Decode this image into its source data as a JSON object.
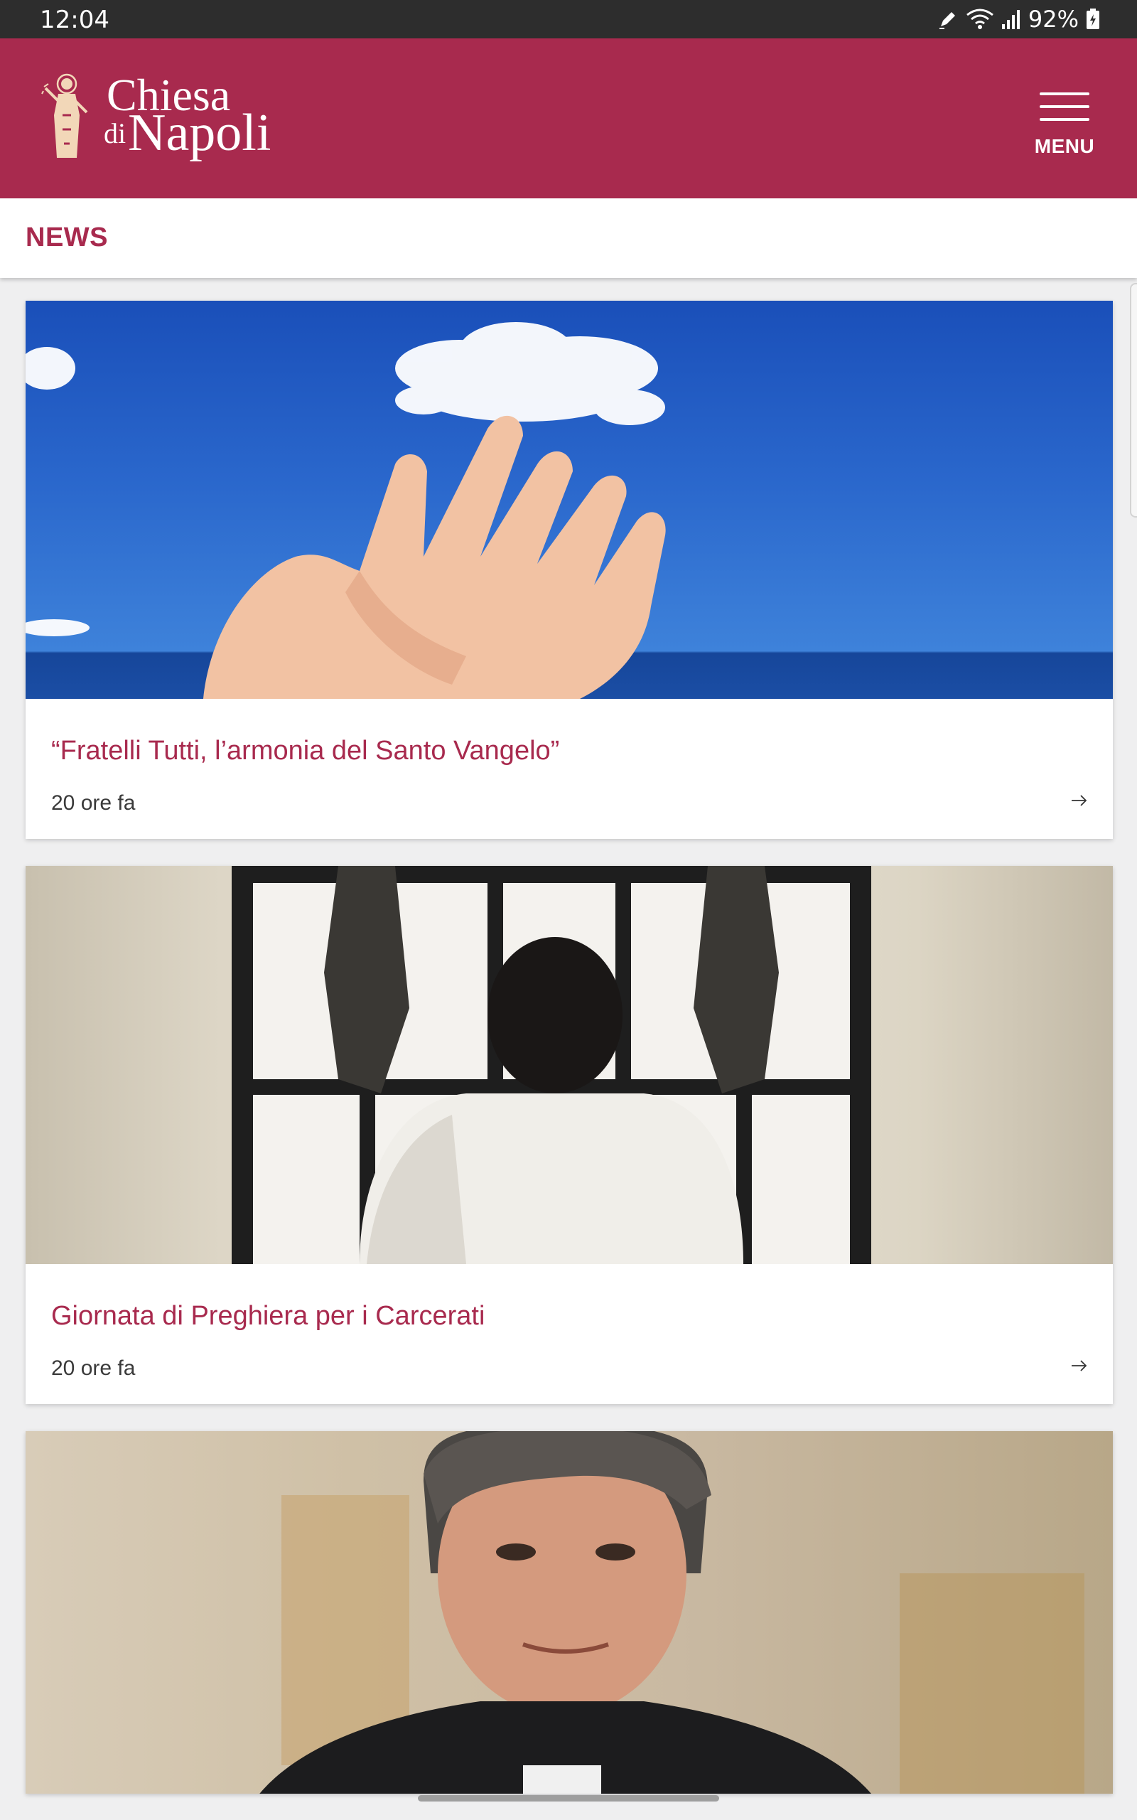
{
  "status_bar": {
    "time": "12:04",
    "battery": "92%",
    "icons": [
      "edit-pen-icon",
      "wifi-icon",
      "signal-icon",
      "battery-icon"
    ]
  },
  "app_bar": {
    "logo": {
      "line1": "Chiesa",
      "line2_prefix": "di",
      "line2": "Napoli"
    },
    "menu_label": "MENU",
    "background_color": "#a82a4e"
  },
  "section": {
    "title": "NEWS"
  },
  "articles": [
    {
      "title": "“Fratelli Tutti, l’armonia del Santo Vangelo”",
      "time": "20 ore fa",
      "image": "open hand under a cloud in blue sky"
    },
    {
      "title": "Giornata di Preghiera per i Carcerati",
      "time": "20 ore fa",
      "image": "person holding prison window bars"
    },
    {
      "title": "",
      "time": "",
      "image": "portrait of a priest"
    }
  ],
  "colors": {
    "accent": "#a82a4e",
    "page_background": "#efeff0",
    "status_bar": "#2d2d2d"
  }
}
